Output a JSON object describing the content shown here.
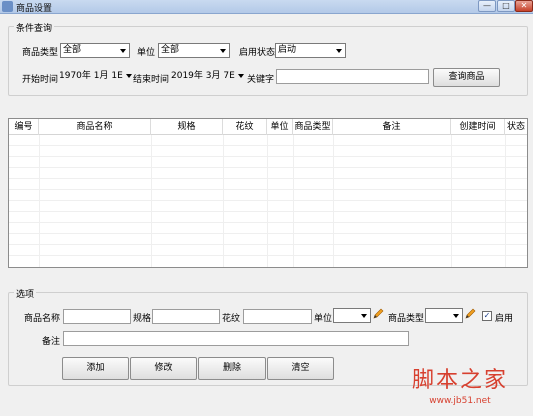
{
  "window": {
    "title": "商品设置",
    "min_glyph": "—",
    "max_glyph": "□",
    "close_glyph": "✕"
  },
  "query": {
    "group_title": "条件查询",
    "category_label": "商品类型",
    "category_value": "全部",
    "unit_label": "单位",
    "unit_value": "全部",
    "status_label": "启用状态",
    "status_value": "启动",
    "start_label": "开始时间",
    "start_value": "1970年 1月 1E",
    "end_label": "结束时间",
    "end_value": "2019年 3月 7E",
    "keyword_label": "关键字",
    "keyword_value": "",
    "search_button": "查询商品"
  },
  "grid": {
    "columns": [
      "编号",
      "商品名称",
      "规格",
      "花纹",
      "单位",
      "商品类型",
      "备注",
      "创建时间",
      "状态"
    ]
  },
  "options": {
    "group_title": "选项",
    "name_label": "商品名称",
    "spec_label": "规格",
    "pattern_label": "花纹",
    "unit_label": "单位",
    "type_label": "商品类型",
    "enable_label": "启用",
    "enable_checked": true,
    "check_glyph": "✓",
    "remark_label": "备注"
  },
  "buttons": {
    "add": "添加",
    "edit": "修改",
    "delete": "删除",
    "clear": "清空"
  },
  "watermark": {
    "main": "脚本之家",
    "url": "www.jb51.net"
  },
  "colors": {
    "accent": "#d7402f",
    "titlebar": "#b3c9e8"
  },
  "icons": [
    "app-icon",
    "pencil-icon",
    "dropdown-arrow-icon",
    "checkbox-check-icon"
  ]
}
